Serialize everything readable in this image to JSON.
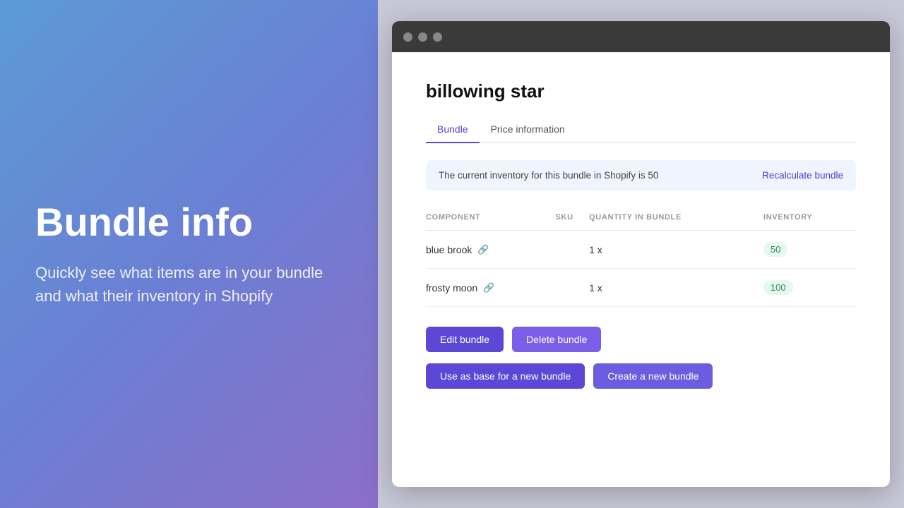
{
  "left": {
    "hero_title": "Bundle info",
    "hero_desc": "Quickly see what items are in your bundle and what their inventory in Shopify"
  },
  "browser": {
    "app_title": "billowing star",
    "tabs": [
      {
        "label": "Bundle",
        "active": true
      },
      {
        "label": "Price information",
        "active": false
      }
    ],
    "info_banner": {
      "text": "The current inventory for this bundle in Shopify is 50",
      "recalculate_label": "Recalculate bundle"
    },
    "table": {
      "headers": [
        "Component",
        "SKU",
        "Quantity in Bundle",
        "Inventory"
      ],
      "rows": [
        {
          "component": "blue brook",
          "sku": "",
          "quantity": "1 x",
          "inventory": "50",
          "inv_class": "green"
        },
        {
          "component": "frosty moon",
          "sku": "",
          "quantity": "1 x",
          "inventory": "100",
          "inv_class": "green"
        }
      ]
    },
    "actions": {
      "edit_label": "Edit bundle",
      "delete_label": "Delete bundle"
    },
    "secondary_actions": {
      "use_as_base_label": "Use as base for a new bundle",
      "create_new_label": "Create a new bundle"
    }
  }
}
